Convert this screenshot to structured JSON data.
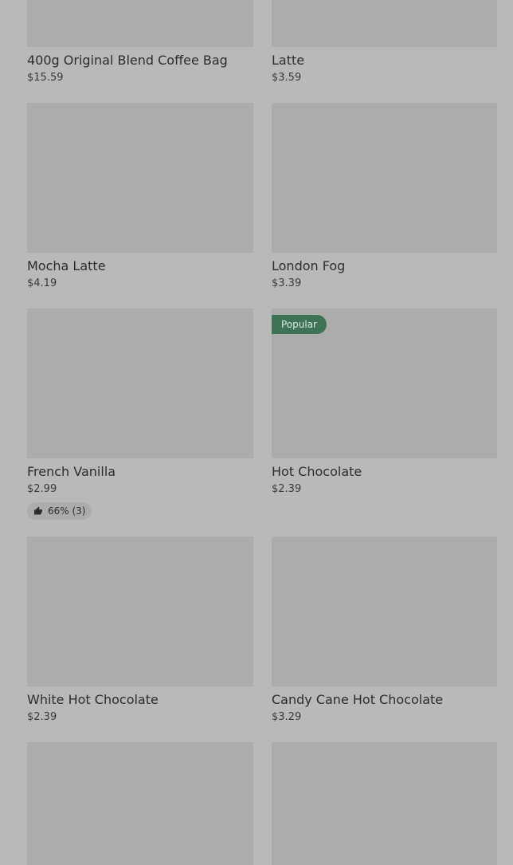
{
  "products": [
    {
      "name": "400g Original Blend Coffee Bag",
      "price": "$15.59"
    },
    {
      "name": "Latte",
      "price": "$3.59"
    },
    {
      "name": "Mocha Latte",
      "price": "$4.19"
    },
    {
      "name": "London Fog",
      "price": "$3.39"
    },
    {
      "name": "French Vanilla",
      "price": "$2.99",
      "rating": "66% (3)"
    },
    {
      "name": "Hot Chocolate",
      "price": "$2.39",
      "badge": "Popular"
    },
    {
      "name": "White Hot Chocolate",
      "price": "$2.39"
    },
    {
      "name": "Candy Cane Hot Chocolate",
      "price": "$3.29"
    }
  ],
  "icons": {
    "rating": "thumbs-up-icon"
  },
  "colors": {
    "badge_bg": "#3f7355",
    "background": "#b9b9b9",
    "thumb": "#acacac"
  }
}
